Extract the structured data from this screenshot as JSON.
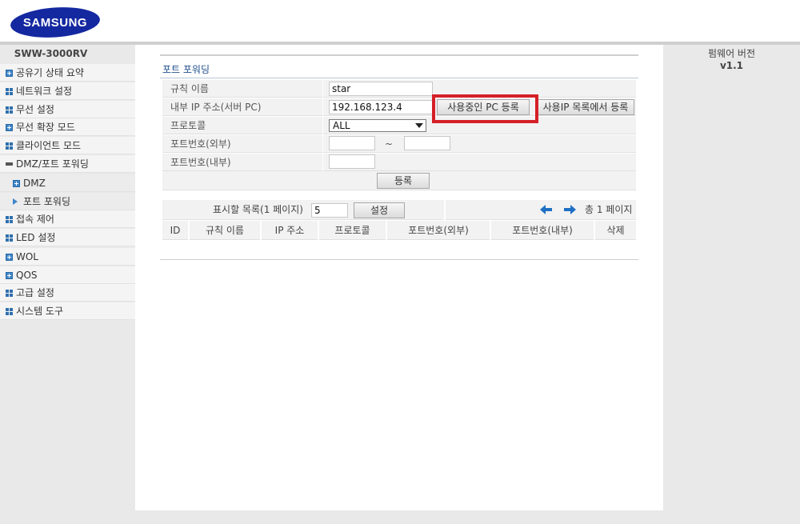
{
  "brand": {
    "name": "SAMSUNG",
    "color": "#1428a0"
  },
  "sidebar": {
    "model": "SWW-3000RV",
    "items": [
      {
        "label": "공유기 상태 요약",
        "icon": "plus-square-icon"
      },
      {
        "label": "네트워크 설정",
        "icon": "grid-icon"
      },
      {
        "label": "무선 설정",
        "icon": "grid-icon"
      },
      {
        "label": "무선 확장 모드",
        "icon": "plus-square-icon"
      },
      {
        "label": "클라이언트 모드",
        "icon": "grid-icon"
      },
      {
        "label": "DMZ/포트 포워딩",
        "icon": "minus-icon"
      },
      {
        "label": "DMZ",
        "icon": "plus-square-icon"
      },
      {
        "label": "포트 포워딩",
        "icon": "arrow-right-icon"
      },
      {
        "label": "접속 제어",
        "icon": "grid-icon"
      },
      {
        "label": "LED 설정",
        "icon": "grid-icon"
      },
      {
        "label": "WOL",
        "icon": "plus-square-icon"
      },
      {
        "label": "QOS",
        "icon": "plus-square-icon"
      },
      {
        "label": "고급 설정",
        "icon": "grid-icon"
      },
      {
        "label": "시스템 도구",
        "icon": "grid-icon"
      }
    ]
  },
  "main": {
    "title": "포트 포워딩",
    "form": {
      "rule_name_label": "규칙 이름",
      "rule_name_value": "star",
      "internal_ip_label": "내부 IP 주소(서버 PC)",
      "internal_ip_value": "192.168.123.4",
      "register_current_pc_button": "사용중인 PC 등록",
      "register_from_ip_list_button": "사용IP 목록에서 등록",
      "protocol_label": "프로토콜",
      "protocol_value": "ALL",
      "external_port_label": "포트번호(외부)",
      "external_port_start": "",
      "external_port_end": "",
      "port_range_separator": "~",
      "internal_port_label": "포트번호(내부)",
      "internal_port_value": "",
      "register_button": "등록"
    },
    "list": {
      "display_count_label": "표시할 목록(1 페이지)",
      "display_count_value": "5",
      "set_button": "설정",
      "page_info": "총 1 페이지",
      "columns": [
        "ID",
        "규칙 이름",
        "IP 주소",
        "프로토콜",
        "포트번호(외부)",
        "포트번호(내부)",
        "삭제"
      ],
      "rows": []
    }
  },
  "firmware": {
    "label": "펌웨어 버전",
    "version": "v1.1"
  },
  "colors": {
    "highlight": "#d51f27",
    "title": "#1f4e8c",
    "icon_blue": "#3f86c8"
  }
}
